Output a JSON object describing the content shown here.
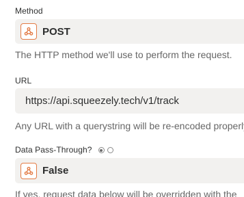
{
  "method": {
    "label": "Method",
    "value": "POST",
    "icon": "webhook-icon",
    "help": "The HTTP method we'll use to perform the request."
  },
  "url": {
    "label": "URL",
    "value": "https://api.squeezely.tech/v1/track",
    "help": "Any URL with a querystring will be re-encoded properly."
  },
  "pass_through": {
    "label": "Data Pass-Through?",
    "value": "False",
    "icon": "webhook-icon",
    "radio_selected": "first",
    "help": "If yes, request data below will be overridden with the"
  },
  "colors": {
    "field_bg": "#f2f1ef",
    "icon_accent": "#e37b45",
    "text": "#2d2e2e",
    "help_text": "#666666"
  }
}
